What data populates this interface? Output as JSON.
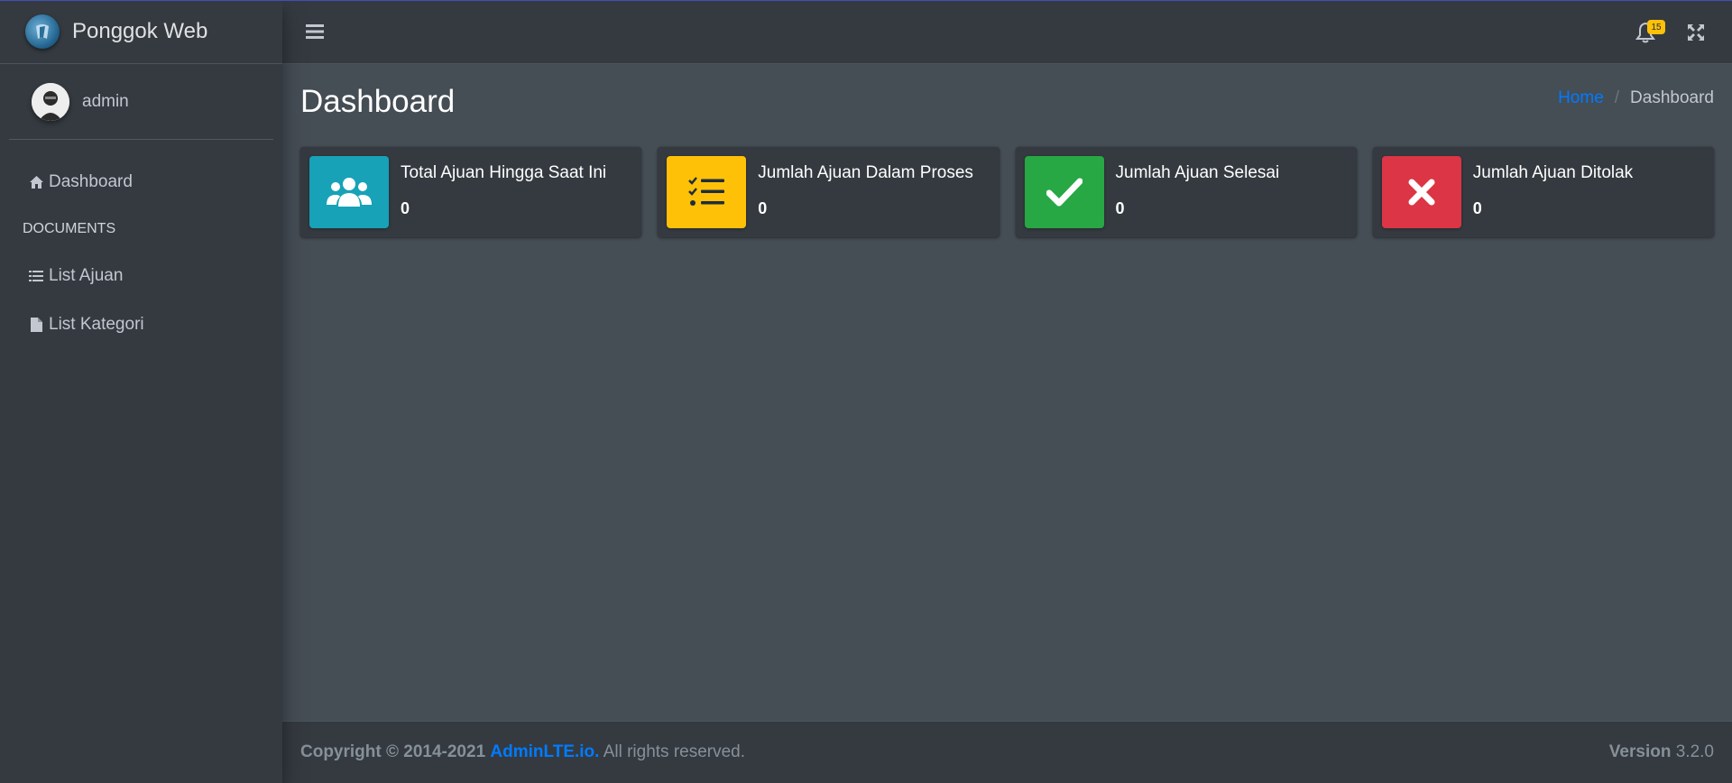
{
  "brand": {
    "name": "Ponggok Web"
  },
  "user": {
    "name": "admin"
  },
  "sidebar": {
    "items": [
      {
        "label": "Dashboard",
        "icon": "home-icon"
      },
      {
        "label": "List Ajuan",
        "icon": "list-icon"
      },
      {
        "label": "List Kategori",
        "icon": "file-icon"
      }
    ],
    "section_header": "DOCUMENTS"
  },
  "topbar": {
    "notification_count": "15"
  },
  "page": {
    "title": "Dashboard",
    "breadcrumb": {
      "home": "Home",
      "separator": "/",
      "current": "Dashboard"
    }
  },
  "info_boxes": [
    {
      "label": "Total Ajuan Hingga Saat Ini",
      "value": "0",
      "color": "#17a2b8",
      "icon": "users-icon"
    },
    {
      "label": "Jumlah Ajuan Dalam Proses",
      "value": "0",
      "color": "#ffc107",
      "icon": "tasks-icon"
    },
    {
      "label": "Jumlah Ajuan Selesai",
      "value": "0",
      "color": "#28a745",
      "icon": "check-icon"
    },
    {
      "label": "Jumlah Ajuan Ditolak",
      "value": "0",
      "color": "#dc3545",
      "icon": "times-icon"
    }
  ],
  "footer": {
    "copyright": "Copyright © 2014-2021",
    "link": "AdminLTE.io.",
    "rights": "All rights reserved.",
    "version_label": "Version",
    "version": "3.2.0"
  }
}
